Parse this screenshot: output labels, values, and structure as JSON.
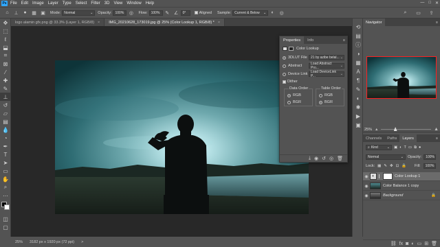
{
  "menu": [
    "File",
    "Edit",
    "Image",
    "Layer",
    "Type",
    "Select",
    "Filter",
    "3D",
    "View",
    "Window",
    "Help"
  ],
  "window_controls": [
    "—",
    "□",
    "✕"
  ],
  "options": {
    "mode_label": "Mode:",
    "mode_value": "Normal",
    "opacity_label": "Opacity:",
    "opacity_value": "100%",
    "flow_label": "Flow:",
    "flow_value": "100%",
    "angle_value": "0°",
    "aligned_label": "Aligned",
    "sample_label": "Sample:",
    "sample_value": "Current & Below"
  },
  "tabs": [
    {
      "label": "logo alamin gfx.png @ 33.3% (Layer 1, RGB/8)",
      "close": "×"
    },
    {
      "label": "IMG_20210628_173019.jpg @ 25% (Color Lookup 1, RGB/8) *",
      "close": "×"
    }
  ],
  "status": {
    "zoom": "25%",
    "doc": "3182 px x 1920 px (72 ppi)",
    "arrow": ">"
  },
  "properties": {
    "tab_properties": "Properties",
    "tab_info": "Info",
    "title": "Color Lookup",
    "lut3d_label": "3DLUT File",
    "lut3d_value": "21 by azibe belal...",
    "abstract_label": "Abstract",
    "abstract_value": "Load Abstract Pro...",
    "devicelink_label": "Device Link",
    "devicelink_value": "Load DeviceLink P...",
    "dither_label": "Dither",
    "data_order_label": "Data Order",
    "table_order_label": "Table Order",
    "rgb": "RGB",
    "bgr": "BGR"
  },
  "navigator": {
    "tab": "Navigator",
    "zoom": "25%"
  },
  "layers": {
    "tab_channels": "Channels",
    "tab_paths": "Paths",
    "tab_layers": "Layers",
    "kind": "Kind",
    "blend": "Normal",
    "opacity_label": "Opacity:",
    "opacity_value": "100%",
    "lock_label": "Lock:",
    "fill_label": "Fill:",
    "fill_value": "100%",
    "items": [
      {
        "name": "Color Lookup 1"
      },
      {
        "name": "Color Balance 1 copy"
      },
      {
        "name": "Background"
      }
    ]
  },
  "colors": {
    "accent": "#31a8ff",
    "sky_top": "#0f3a40",
    "sky_mid": "#5a9aa0",
    "glow": "#d8f4f6"
  }
}
